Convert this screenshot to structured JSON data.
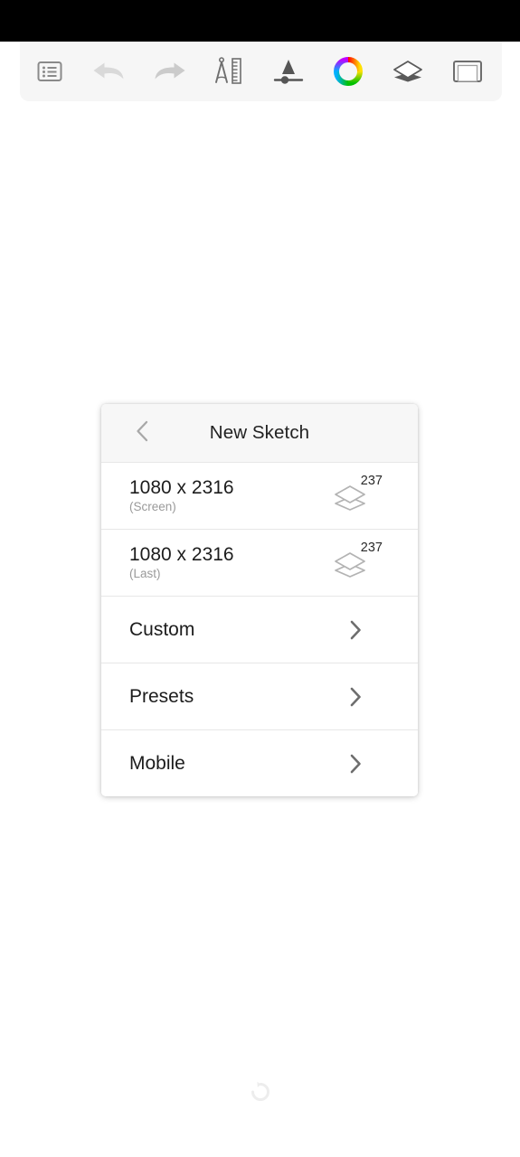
{
  "app": {
    "canvas_background": "#ffffff",
    "status_bar_color": "#000000"
  },
  "toolbar": {
    "background": "#f6f6f6",
    "items": [
      {
        "name": "menu-list-icon",
        "label": "Menu",
        "state": "enabled",
        "color": "#7a7a7a"
      },
      {
        "name": "undo-icon",
        "label": "Undo",
        "state": "disabled",
        "color": "#d8d8d8"
      },
      {
        "name": "redo-icon",
        "label": "Redo",
        "state": "disabled",
        "color": "#c9c9c9"
      },
      {
        "name": "compass-ruler-icon",
        "label": "Tools",
        "state": "enabled",
        "color": "#6e6e6e"
      },
      {
        "name": "brush-size-icon",
        "label": "Brush",
        "state": "enabled",
        "color": "#555555"
      },
      {
        "name": "color-wheel-icon",
        "label": "Color",
        "state": "enabled",
        "color": "#ff0000"
      },
      {
        "name": "layers-icon",
        "label": "Layers",
        "state": "enabled",
        "color": "#6e6e6e"
      },
      {
        "name": "canvas-frame-icon",
        "label": "Canvas",
        "state": "enabled",
        "color": "#6e6e6e"
      }
    ]
  },
  "dialog": {
    "title": "New Sketch",
    "back_label": "Back",
    "size_rows": [
      {
        "size": "1080 x 2316",
        "source": "(Screen)",
        "layer_count": "237",
        "layers_icon": "layers-icon"
      },
      {
        "size": "1080 x 2316",
        "source": "(Last)",
        "layer_count": "237",
        "layers_icon": "layers-icon"
      }
    ],
    "nav_rows": [
      {
        "label": "Custom",
        "chevron": "chevron-right-icon"
      },
      {
        "label": "Presets",
        "chevron": "chevron-right-icon"
      },
      {
        "label": "Mobile",
        "chevron": "chevron-right-icon"
      }
    ]
  },
  "footer": {
    "indicator": "refresh-icon"
  }
}
